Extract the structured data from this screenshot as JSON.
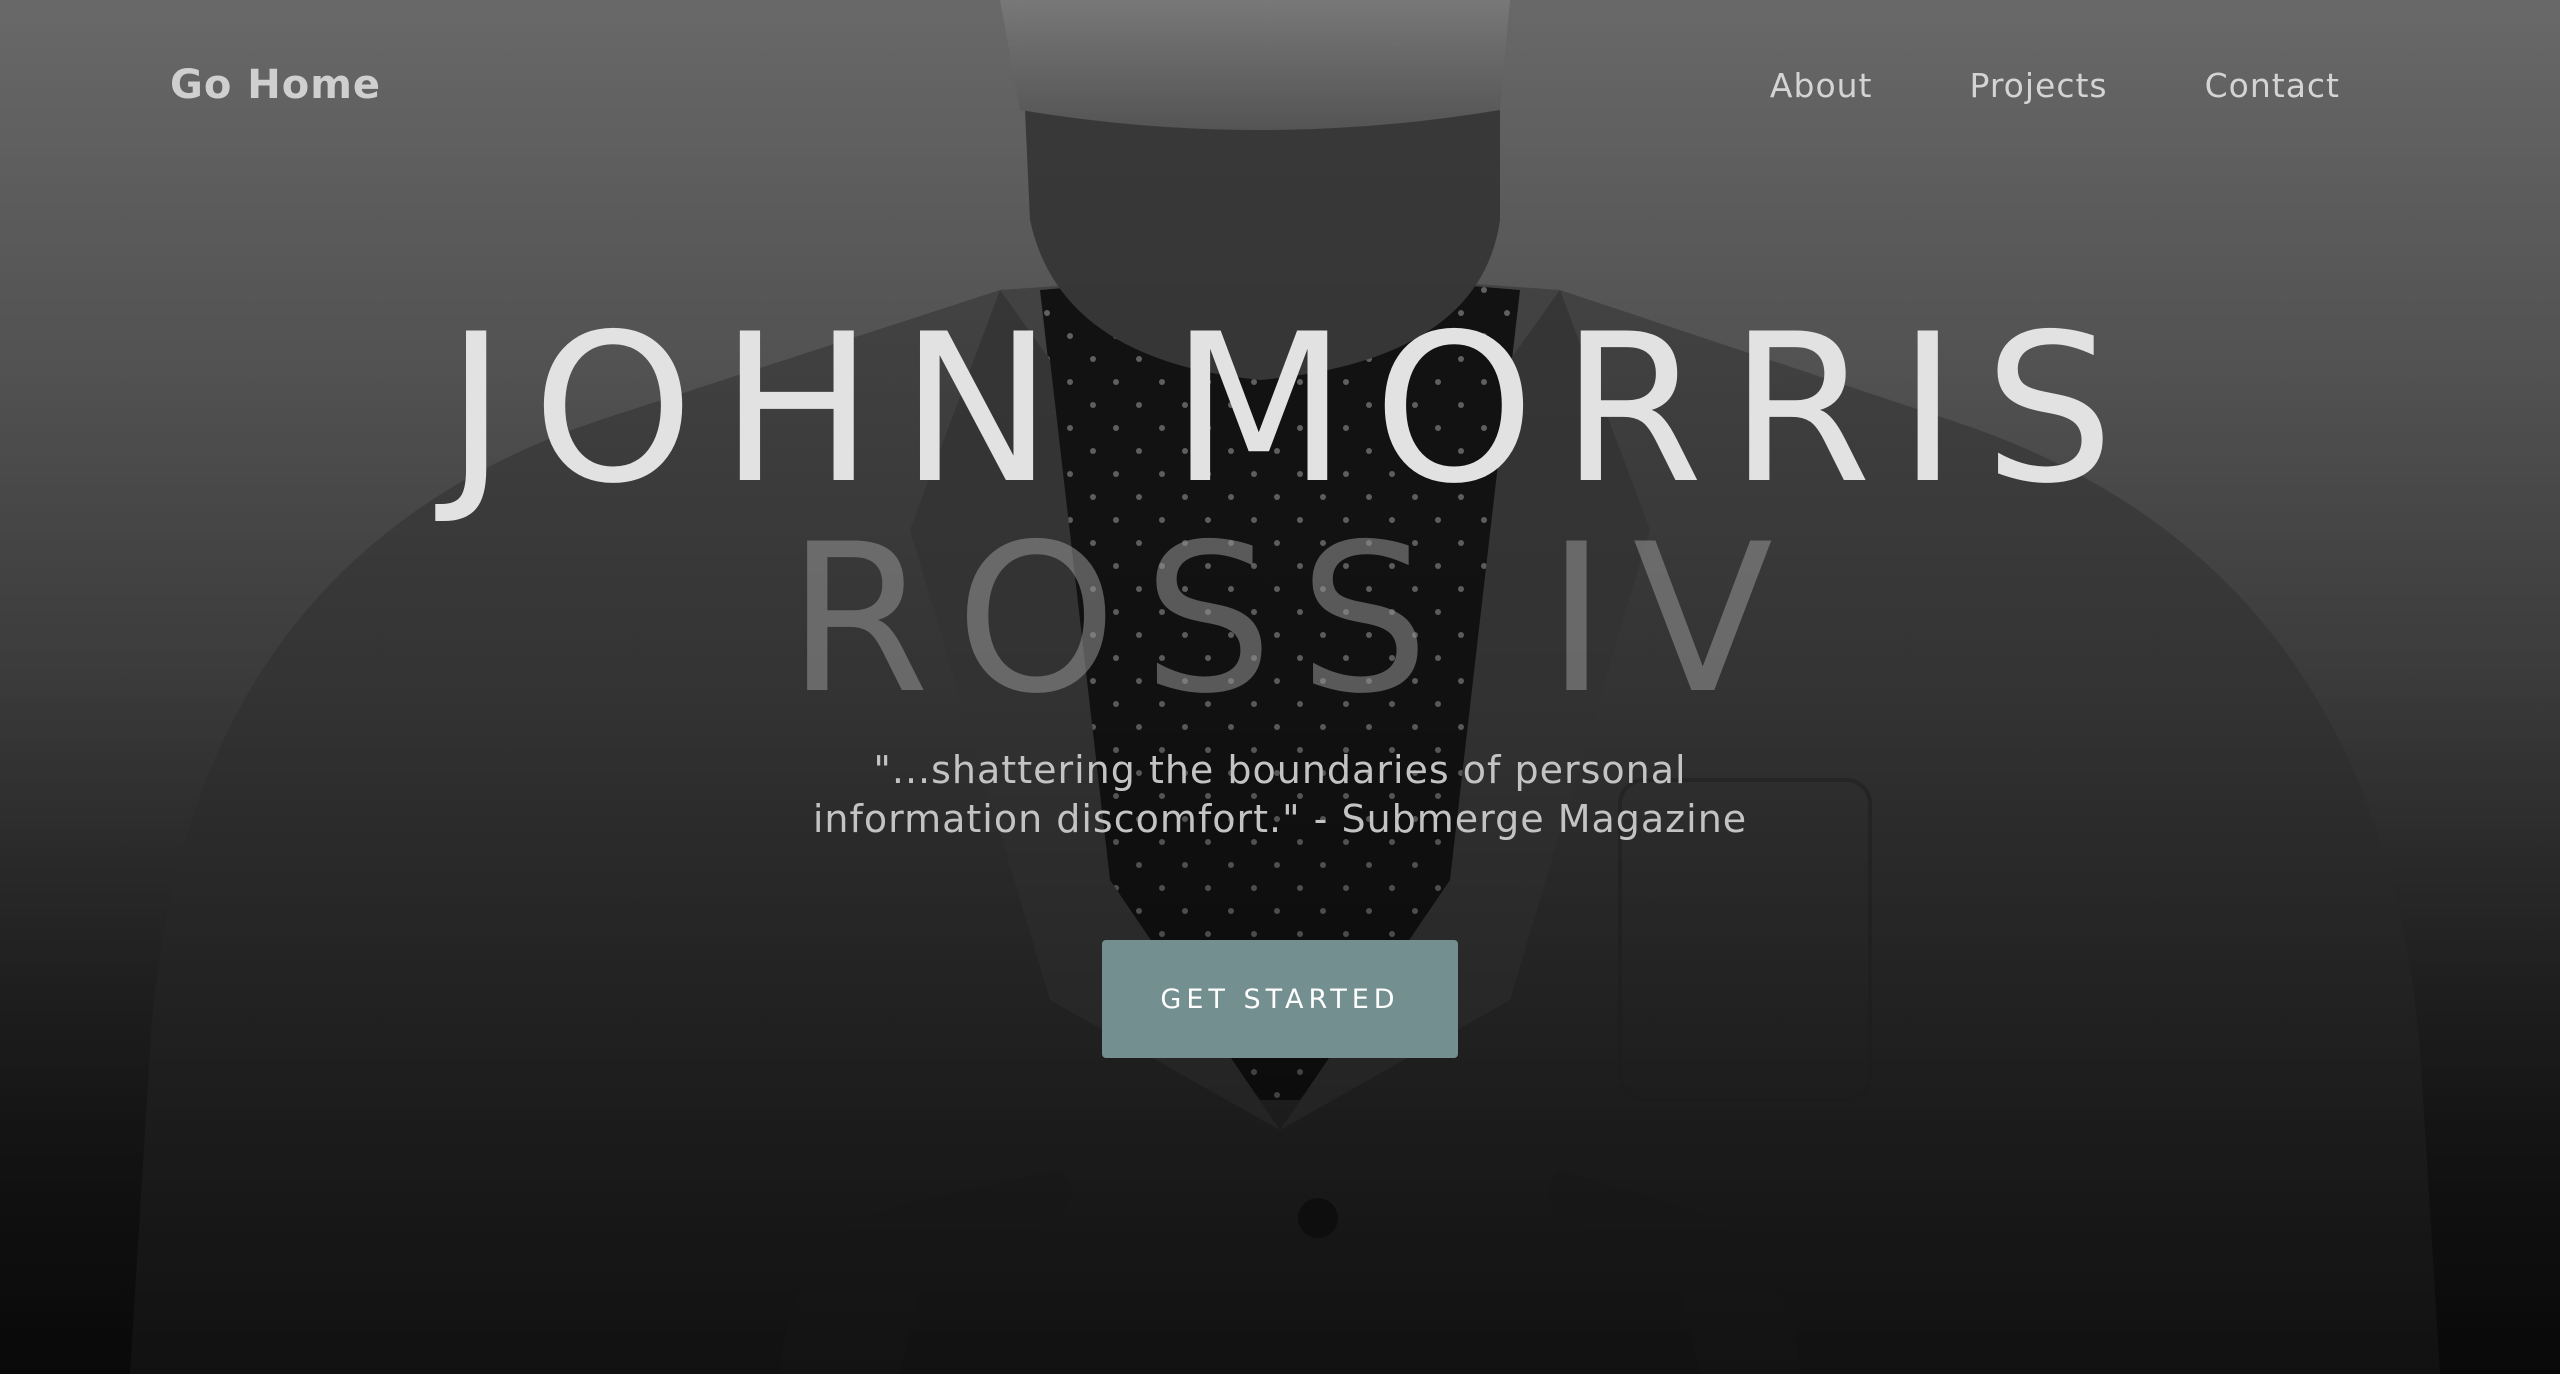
{
  "nav": {
    "brand": "Go Home",
    "links": [
      {
        "label": "About"
      },
      {
        "label": "Projects"
      },
      {
        "label": "Contact"
      }
    ]
  },
  "hero": {
    "title_line1": "JOHN MORRIS",
    "title_line2": "ROSS IV",
    "quote_line1": "\"...shattering the boundaries of personal",
    "quote_line2": "information discomfort.\" - Submerge Magazine",
    "cta_label": "GET STARTED"
  },
  "colors": {
    "accent_button": "#738f90",
    "text_light": "#e2e2e2"
  }
}
